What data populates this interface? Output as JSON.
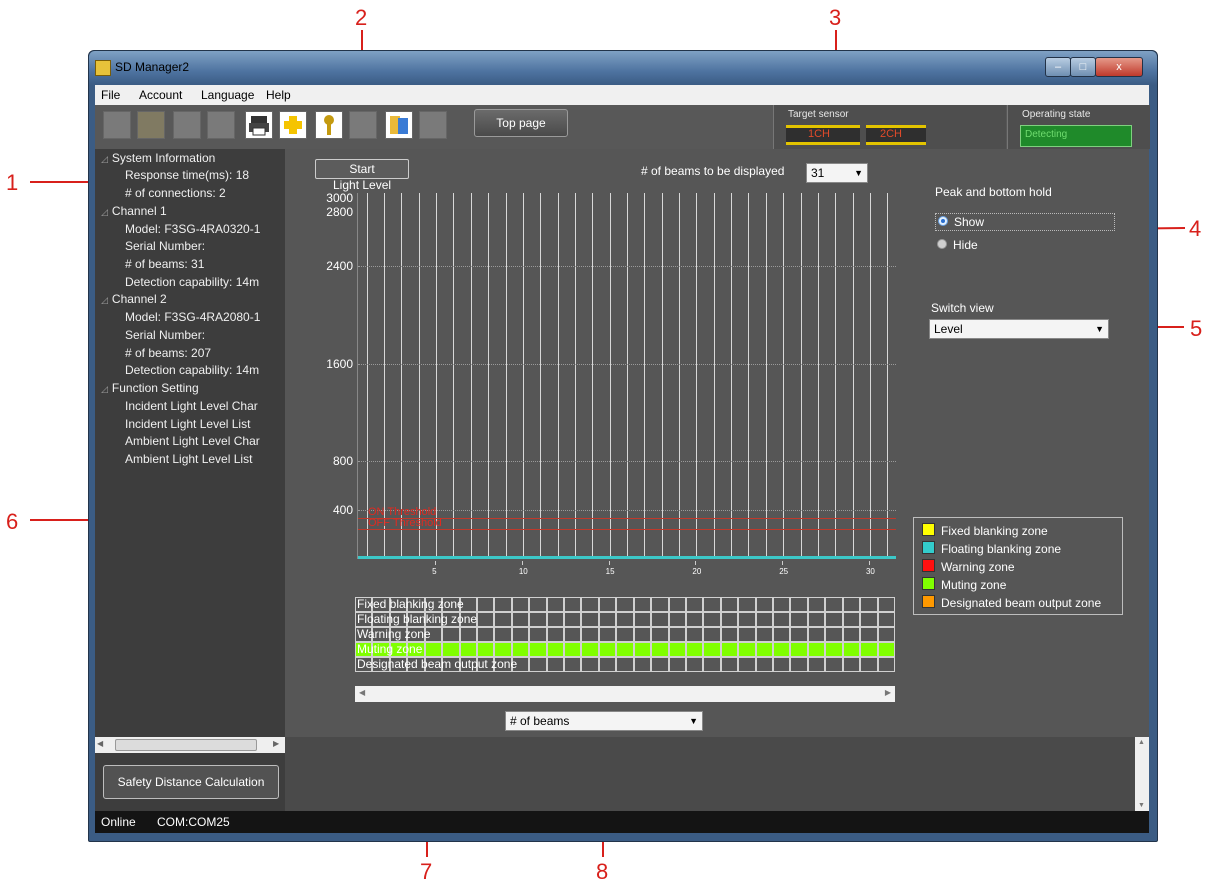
{
  "app": {
    "title": "SD Manager2"
  },
  "window_buttons": {
    "minimize": "–",
    "maximize": "□",
    "close": "x"
  },
  "menu": [
    "File",
    "Account",
    "Language",
    "Help"
  ],
  "toolbar": {
    "top_page_label": "Top page",
    "target_sensor_label": "Target sensor",
    "ch1": "1CH",
    "ch2": "2CH",
    "operating_state_label": "Operating state",
    "operating_state_value": "Detecting"
  },
  "tree": {
    "system_info": "System Information",
    "response_time": "Response time(ms): 18",
    "connections": "# of connections: 2",
    "channel1": "Channel 1",
    "ch1_model": "Model: F3SG-4RA0320-1",
    "ch1_serial": "Serial Number:",
    "ch1_beams": "# of beams: 31",
    "ch1_detect": "Detection capability: 14m",
    "channel2": "Channel 2",
    "ch2_model": "Model: F3SG-4RA2080-1",
    "ch2_serial": "Serial Number:",
    "ch2_beams": "# of beams: 207",
    "ch2_detect": "Detection capability: 14m",
    "function_setting": "Function Setting",
    "f1": "Incident Light Level Char",
    "f2": "Incident Light Level List",
    "f3": "Ambient Light Level Char",
    "f4": "Ambient Light Level List"
  },
  "safety_button": "Safety Distance Calculation",
  "status": {
    "online": "Online",
    "com": "COM:COM25"
  },
  "main": {
    "start_label": "Start",
    "beams_displayed_label": "# of beams to be displayed",
    "beams_displayed_value": "31",
    "peak_hold_label": "Peak and bottom hold",
    "show_label": "Show",
    "hide_label": "Hide",
    "switch_view_label": "Switch view",
    "switch_view_value": "Level",
    "bottom_dropdown_value": "# of beams"
  },
  "chart_data": {
    "type": "bar",
    "ylabel": "Light Level",
    "yticks": [
      "3000",
      "2800",
      "2400",
      "1600",
      "800",
      "400"
    ],
    "xticks": [
      "5",
      "10",
      "15",
      "20",
      "25",
      "30"
    ],
    "beam_count": 31,
    "ylim": [
      0,
      3000
    ],
    "on_threshold_label": "ON Threshold",
    "off_threshold_label": "OFF Threshold"
  },
  "zones": {
    "fixed": "Fixed blanking zone",
    "floating": "Floating blanking zone",
    "warning": "Warning zone",
    "muting": "Muting zone",
    "designated": "Designated beam output zone"
  },
  "legend": [
    {
      "label": "Fixed blanking zone",
      "color": "#ffff00"
    },
    {
      "label": "Floating blanking zone",
      "color": "#33cccc"
    },
    {
      "label": "Warning zone",
      "color": "#ff1010"
    },
    {
      "label": "Muting zone",
      "color": "#80ff00"
    },
    {
      "label": "Designated beam output zone",
      "color": "#ff9900"
    }
  ],
  "callouts": [
    "1",
    "2",
    "3",
    "4",
    "5",
    "6",
    "7",
    "8"
  ]
}
